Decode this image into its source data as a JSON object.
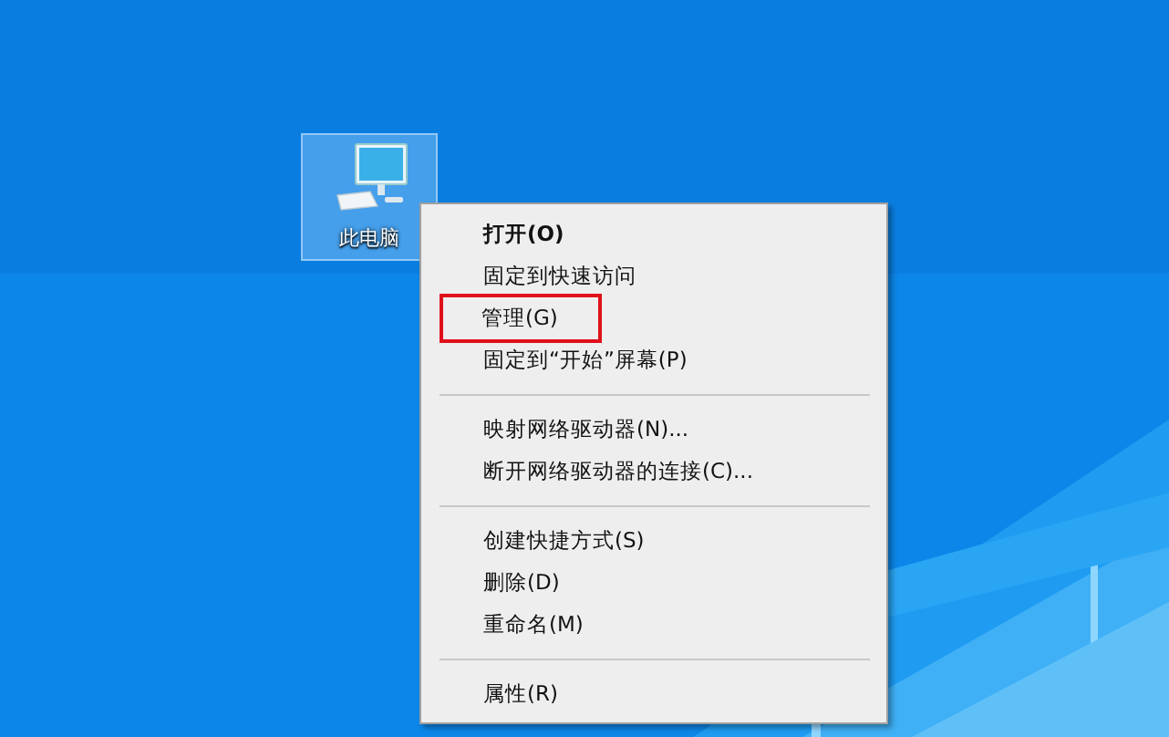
{
  "desktop_icons": [
    {
      "label": "此电脑",
      "selected": true
    }
  ],
  "context_menu": {
    "groups": [
      {
        "items": [
          {
            "label": "打开(O)",
            "default": true,
            "highlighted": false
          },
          {
            "label": "固定到快速访问",
            "default": false,
            "highlighted": false
          },
          {
            "label": "管理(G)",
            "default": false,
            "highlighted": true
          },
          {
            "label": "固定到“开始”屏幕(P)",
            "default": false,
            "highlighted": false
          }
        ]
      },
      {
        "items": [
          {
            "label": "映射网络驱动器(N)...",
            "default": false,
            "highlighted": false
          },
          {
            "label": "断开网络驱动器的连接(C)...",
            "default": false,
            "highlighted": false
          }
        ]
      },
      {
        "items": [
          {
            "label": "创建快捷方式(S)",
            "default": false,
            "highlighted": false
          },
          {
            "label": "删除(D)",
            "default": false,
            "highlighted": false
          },
          {
            "label": "重命名(M)",
            "default": false,
            "highlighted": false
          }
        ]
      },
      {
        "items": [
          {
            "label": "属性(R)",
            "default": false,
            "highlighted": false
          }
        ]
      }
    ]
  }
}
